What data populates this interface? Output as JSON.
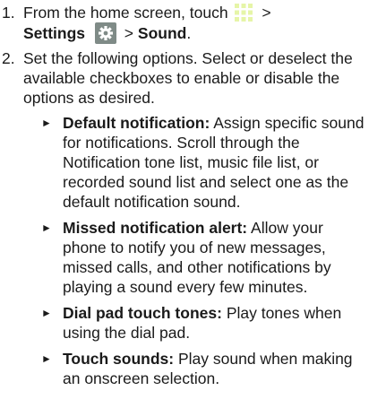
{
  "steps": [
    {
      "number": "1.",
      "prefix": "From the home screen, touch",
      "after_icon": ">",
      "settings_label": "Settings",
      "sep": ">",
      "sound_label": "Sound",
      "end": "."
    },
    {
      "number": "2.",
      "text": "Set the following options. Select or deselect the available checkboxes to enable or disable the options as desired."
    }
  ],
  "options": [
    {
      "title": "Default notification:",
      "description": "Assign specific sound for notifications. Scroll through the Notification tone list, music file list, or recorded sound list and select one as the default notification sound."
    },
    {
      "title": "Missed notification alert:",
      "description": "Allow your phone to notify you of new messages, missed calls, and other notifications by playing a sound every few minutes."
    },
    {
      "title": "Dial pad touch tones:",
      "description": "Play tones when using the dial pad."
    },
    {
      "title": "Touch sounds:",
      "description": "Play sound when making an onscreen selection."
    }
  ],
  "bullet_glyph": "►",
  "icons": {
    "apps": "apps-grid-icon",
    "settings": "gear-icon"
  },
  "colors": {
    "apps_grid": "#e6f5a8",
    "gear_bg": "#7f8b87",
    "gear_fg": "#ffffff"
  }
}
